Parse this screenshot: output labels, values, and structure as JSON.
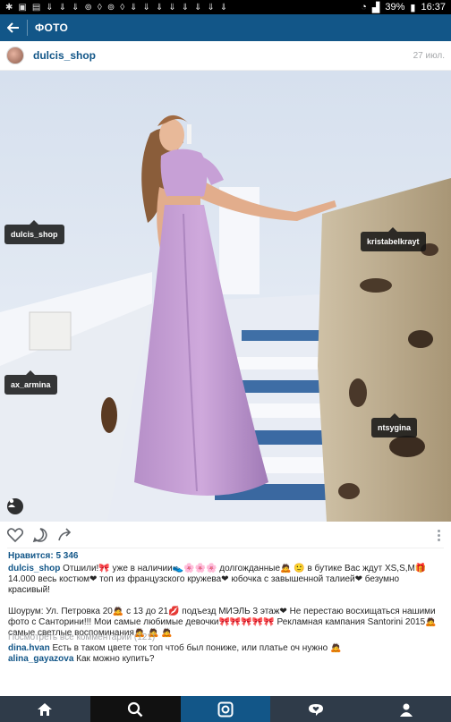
{
  "status_bar": {
    "battery": "39%",
    "time": "16:37"
  },
  "toolbar": {
    "title": "ФОТО"
  },
  "post": {
    "username": "dulcis_shop",
    "time": "27 июл."
  },
  "tags": [
    "dulcis_shop",
    "kristabelkrayt",
    "ax_armina",
    "ntsygina"
  ],
  "likes": "Нравится: 5 346",
  "caption": {
    "user": "dulcis_shop",
    "p1": "Отшили!🎀 уже в наличии👟🌸🌸🌸 долгожданные🙇 🙂 в бутике Вас ждут XS,S,M🎁 14.000  весь костюм❤ топ из французского кружева❤ юбочка с завышенной талией❤ безумно красивый!",
    "p2": "Шоурум: Ул. Петровка 20🙇 с 13 до 21💋 подъезд МИЭЛЬ 3 этаж❤ Не перестаю восхищаться нашими фото с Санторини!!! Мои самые любимые девочки🎀🎀🎀🎀🎀 Рекламная кампания Santorini 2015🙇  самые светлые воспоминания🙇 🙇 🙇"
  },
  "view_all_comments": "Посмотреть все комментарии (121)",
  "comments": [
    {
      "user": "dina.hvan",
      "text": "Есть в таком цвете ток топ чтоб был пониже, или платье оч нужно 🙇"
    },
    {
      "user": "alina_gayazova",
      "text": "Как можно купить?"
    }
  ],
  "colors": {
    "primary": "#125688",
    "nav_background": "#2f3b49",
    "meta_gray": "#a5a7aa"
  }
}
